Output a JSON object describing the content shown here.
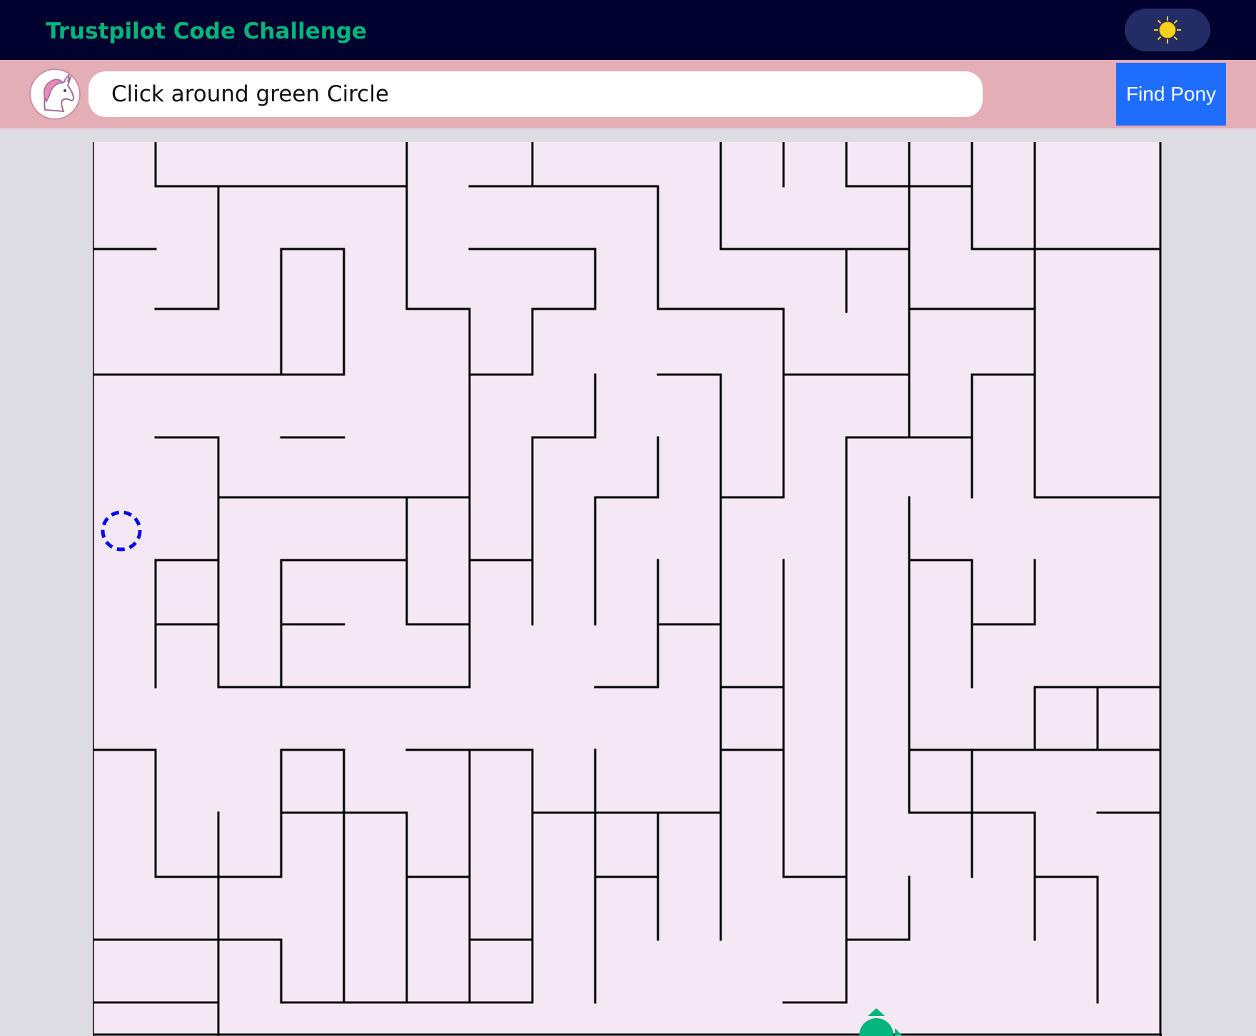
{
  "header": {
    "title": "Trustpilot Code Challenge",
    "theme_icon": "sun-icon",
    "colors": {
      "bar": "#02022e",
      "title": "#04b57c",
      "toggle": "#232c64",
      "sun": "#f7d21c"
    }
  },
  "controls": {
    "avatar_icon": "unicorn-icon",
    "input_value": "Click around green Circle",
    "find_button": "Find Pony",
    "colors": {
      "bar": "#e3aeb6",
      "button": "#1f6dfd"
    }
  },
  "maze": {
    "colors": {
      "floor": "#f3e8f4",
      "wall": "#000000",
      "target": "#0a0ae8",
      "player": "#04b57c"
    },
    "target_icon": "dashed-circle-target-icon",
    "player_icon": "green-circle-player-icon"
  }
}
